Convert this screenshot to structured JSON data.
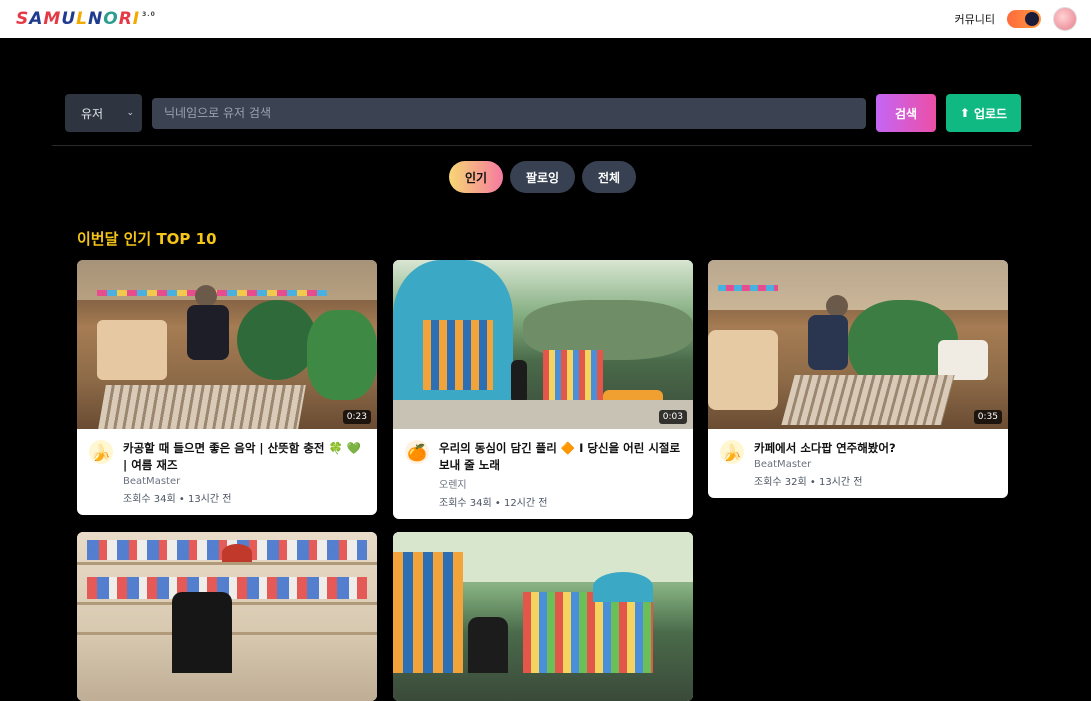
{
  "header": {
    "logo_text": "SAMULNORI",
    "logo_version": "3.0",
    "community_label": "커뮤니티"
  },
  "search": {
    "filter_selected": "유저",
    "placeholder": "닉네임으로 유저 검색",
    "search_label": "검색",
    "upload_label": "업로드"
  },
  "tabs": [
    {
      "label": "인기",
      "active": true
    },
    {
      "label": "팔로잉",
      "active": false
    },
    {
      "label": "전체",
      "active": false
    }
  ],
  "section_title": "이번달 인기 TOP 10",
  "videos": [
    {
      "title": "카공할 때 들으면 좋은 음악 | 산뜻함 충전 🍀 💚 | 여름 재즈",
      "channel": "BeatMaster",
      "stats": "조회수 34회 • 13시간 전",
      "duration": "0:23",
      "avatar_icon": "banana-avatar"
    },
    {
      "title": "우리의 동심이 담긴 플리 🔶 I 당신을 어린 시절로 보내 줄 노래",
      "channel": "오렌지",
      "stats": "조회수 34회 • 12시간 전",
      "duration": "0:03",
      "avatar_icon": "orange-avatar"
    },
    {
      "title": "카페에서 소다팝 연주해봤어?",
      "channel": "BeatMaster",
      "stats": "조회수 32회 • 13시간 전",
      "duration": "0:35",
      "avatar_icon": "banana-avatar"
    },
    {
      "title": "",
      "channel": "",
      "stats": "",
      "duration": "",
      "avatar_icon": ""
    },
    {
      "title": "",
      "channel": "",
      "stats": "",
      "duration": "",
      "avatar_icon": ""
    }
  ]
}
